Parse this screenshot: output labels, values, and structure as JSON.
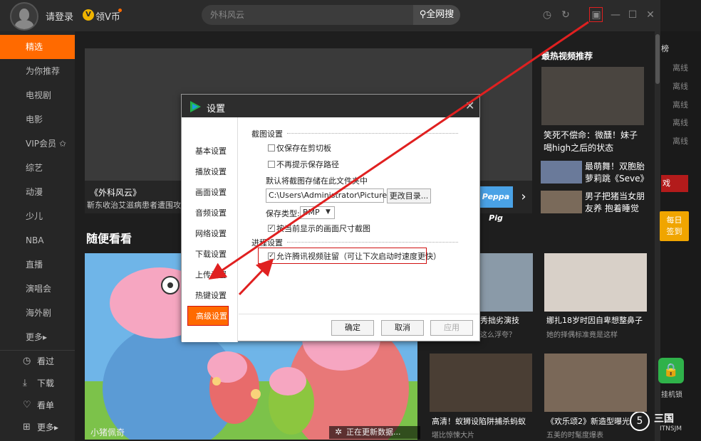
{
  "topbar": {
    "login": "请登录",
    "vip_coin_badge": "V",
    "vip_coin": "领V币",
    "search_placeholder": "外科风云",
    "search_button": "全网搜"
  },
  "sidebar": {
    "items": [
      "精选",
      "为你推荐",
      "电视剧",
      "电影",
      "VIP会员",
      "综艺",
      "动漫",
      "少儿",
      "NBA",
      "直播",
      "演唱会",
      "海外剧",
      "更多▸"
    ],
    "bottom": [
      {
        "icon": "◷",
        "label": "看过"
      },
      {
        "icon": "⤓",
        "label": "下载"
      },
      {
        "icon": "♡",
        "label": "看单"
      },
      {
        "icon": "⊞",
        "label": "更多▸"
      }
    ]
  },
  "banner": {
    "title": "《外科风云》",
    "subtitle": "靳东收治艾滋病患者遭围攻",
    "thumb_text": "Peppa Pig"
  },
  "hot": {
    "title": "最热视频推荐",
    "items": [
      {
        "caption": "笑死不偿命：微醺！妹子喝high之后的状态"
      },
      {
        "caption": "最萌舞！双胞胎萝莉跳《Seve》"
      },
      {
        "caption": "男子把猪当女朋友养 抱着睡觉"
      }
    ]
  },
  "far_right": {
    "rank_label": "榜",
    "offline": [
      "离线",
      "离线",
      "离线",
      "离线",
      "离线"
    ],
    "game": "戏",
    "signin_line1": "每日",
    "signin_line2": "签到",
    "lock_label": "挂机锁",
    "watermark": "三国",
    "watermark_prefix": "5",
    "watermark_sub": "ITNSJM"
  },
  "section": {
    "title": "随便看看",
    "big_caption": "小猪佩奇",
    "cards": [
      {
        "caption": "秀拙劣演技",
        "sub": "这么浮夸？"
      },
      {
        "caption": "娜扎18岁时因自卑想整鼻子",
        "sub": "她的择偶标准竟是这样"
      },
      {
        "caption": "高清！蚁狮设陷阱捕杀蚂蚁",
        "sub": "堪比惊悚大片"
      },
      {
        "caption": "《欢乐颂2》新造型曝光",
        "sub": "五美的时髦度爆表"
      }
    ],
    "updating": "正在更新数据..."
  },
  "dialog": {
    "title": "设置",
    "nav": [
      "基本设置",
      "播放设置",
      "画面设置",
      "音频设置",
      "网络设置",
      "下载设置",
      "上传设置",
      "热键设置",
      "高级设置"
    ],
    "screenshot_section": "截图设置",
    "opt_clipboard": "仅保存在剪切板",
    "opt_no_prompt": "不再提示保存路径",
    "save_folder_label": "默认将截图存储在此文件夹中",
    "path": "C:\\Users\\Administrator\\Pictures",
    "change_dir": "更改目录...",
    "format_label": "保存类型:",
    "format_value": "BMP",
    "opt_current_size": "按当前显示的画面尺寸截图",
    "advanced_section": "进程设置",
    "opt_resident": "允许腾讯视频驻留（可让下次启动时速度更快）",
    "ok": "确定",
    "cancel": "取消",
    "apply": "应用"
  },
  "colors": {
    "accent": "#ff6a00",
    "annotation": "#e02020"
  }
}
